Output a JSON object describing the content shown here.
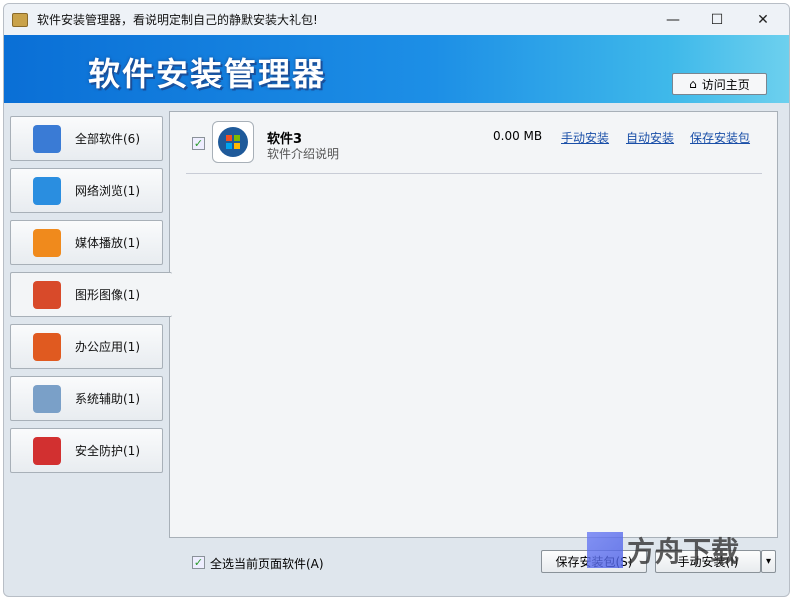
{
  "window": {
    "title": "软件安装管理器，看说明定制自己的静默安装大礼包!",
    "minimize": "—",
    "maximize": "☐",
    "close": "✕"
  },
  "banner": {
    "logo": "软件安装管理器",
    "home_button": "访问主页"
  },
  "sidebar": {
    "items": [
      {
        "label": "全部软件(6)",
        "icon": "windows-icon",
        "color": "#3a7bd5"
      },
      {
        "label": "网络浏览(1)",
        "icon": "ie-icon",
        "color": "#2a8ee0"
      },
      {
        "label": "媒体播放(1)",
        "icon": "media-player-icon",
        "color": "#f08a1c"
      },
      {
        "label": "图形图像(1)",
        "icon": "graphics-icon",
        "color": "#d84a2a",
        "selected": true
      },
      {
        "label": "办公应用(1)",
        "icon": "office-icon",
        "color": "#e05a20"
      },
      {
        "label": "系统辅助(1)",
        "icon": "magnifier-icon",
        "color": "#7aa0c8"
      },
      {
        "label": "安全防护(1)",
        "icon": "shield-icon",
        "color": "#d23030"
      }
    ]
  },
  "software": [
    {
      "name": "软件3",
      "description": "软件介绍说明",
      "size": "0.00 MB",
      "checked": true,
      "links": [
        "手动安装",
        "自动安装",
        "保存安装包"
      ]
    }
  ],
  "footer": {
    "select_all": "全选当前页面软件(A)",
    "save_button": "保存安装包(S)",
    "install_button": "手动安装(I)",
    "dropdown": "▾"
  },
  "watermark": "方舟下载"
}
